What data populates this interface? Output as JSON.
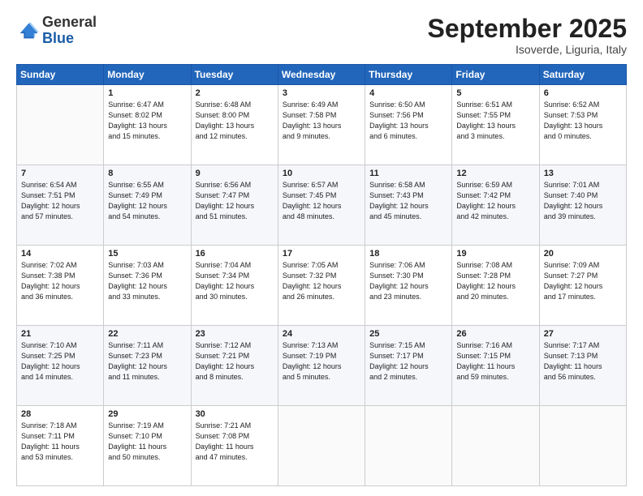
{
  "header": {
    "logo_general": "General",
    "logo_blue": "Blue",
    "month_title": "September 2025",
    "location": "Isoverde, Liguria, Italy"
  },
  "days_of_week": [
    "Sunday",
    "Monday",
    "Tuesday",
    "Wednesday",
    "Thursday",
    "Friday",
    "Saturday"
  ],
  "weeks": [
    [
      {
        "num": "",
        "info": ""
      },
      {
        "num": "1",
        "info": "Sunrise: 6:47 AM\nSunset: 8:02 PM\nDaylight: 13 hours\nand 15 minutes."
      },
      {
        "num": "2",
        "info": "Sunrise: 6:48 AM\nSunset: 8:00 PM\nDaylight: 13 hours\nand 12 minutes."
      },
      {
        "num": "3",
        "info": "Sunrise: 6:49 AM\nSunset: 7:58 PM\nDaylight: 13 hours\nand 9 minutes."
      },
      {
        "num": "4",
        "info": "Sunrise: 6:50 AM\nSunset: 7:56 PM\nDaylight: 13 hours\nand 6 minutes."
      },
      {
        "num": "5",
        "info": "Sunrise: 6:51 AM\nSunset: 7:55 PM\nDaylight: 13 hours\nand 3 minutes."
      },
      {
        "num": "6",
        "info": "Sunrise: 6:52 AM\nSunset: 7:53 PM\nDaylight: 13 hours\nand 0 minutes."
      }
    ],
    [
      {
        "num": "7",
        "info": "Sunrise: 6:54 AM\nSunset: 7:51 PM\nDaylight: 12 hours\nand 57 minutes."
      },
      {
        "num": "8",
        "info": "Sunrise: 6:55 AM\nSunset: 7:49 PM\nDaylight: 12 hours\nand 54 minutes."
      },
      {
        "num": "9",
        "info": "Sunrise: 6:56 AM\nSunset: 7:47 PM\nDaylight: 12 hours\nand 51 minutes."
      },
      {
        "num": "10",
        "info": "Sunrise: 6:57 AM\nSunset: 7:45 PM\nDaylight: 12 hours\nand 48 minutes."
      },
      {
        "num": "11",
        "info": "Sunrise: 6:58 AM\nSunset: 7:43 PM\nDaylight: 12 hours\nand 45 minutes."
      },
      {
        "num": "12",
        "info": "Sunrise: 6:59 AM\nSunset: 7:42 PM\nDaylight: 12 hours\nand 42 minutes."
      },
      {
        "num": "13",
        "info": "Sunrise: 7:01 AM\nSunset: 7:40 PM\nDaylight: 12 hours\nand 39 minutes."
      }
    ],
    [
      {
        "num": "14",
        "info": "Sunrise: 7:02 AM\nSunset: 7:38 PM\nDaylight: 12 hours\nand 36 minutes."
      },
      {
        "num": "15",
        "info": "Sunrise: 7:03 AM\nSunset: 7:36 PM\nDaylight: 12 hours\nand 33 minutes."
      },
      {
        "num": "16",
        "info": "Sunrise: 7:04 AM\nSunset: 7:34 PM\nDaylight: 12 hours\nand 30 minutes."
      },
      {
        "num": "17",
        "info": "Sunrise: 7:05 AM\nSunset: 7:32 PM\nDaylight: 12 hours\nand 26 minutes."
      },
      {
        "num": "18",
        "info": "Sunrise: 7:06 AM\nSunset: 7:30 PM\nDaylight: 12 hours\nand 23 minutes."
      },
      {
        "num": "19",
        "info": "Sunrise: 7:08 AM\nSunset: 7:28 PM\nDaylight: 12 hours\nand 20 minutes."
      },
      {
        "num": "20",
        "info": "Sunrise: 7:09 AM\nSunset: 7:27 PM\nDaylight: 12 hours\nand 17 minutes."
      }
    ],
    [
      {
        "num": "21",
        "info": "Sunrise: 7:10 AM\nSunset: 7:25 PM\nDaylight: 12 hours\nand 14 minutes."
      },
      {
        "num": "22",
        "info": "Sunrise: 7:11 AM\nSunset: 7:23 PM\nDaylight: 12 hours\nand 11 minutes."
      },
      {
        "num": "23",
        "info": "Sunrise: 7:12 AM\nSunset: 7:21 PM\nDaylight: 12 hours\nand 8 minutes."
      },
      {
        "num": "24",
        "info": "Sunrise: 7:13 AM\nSunset: 7:19 PM\nDaylight: 12 hours\nand 5 minutes."
      },
      {
        "num": "25",
        "info": "Sunrise: 7:15 AM\nSunset: 7:17 PM\nDaylight: 12 hours\nand 2 minutes."
      },
      {
        "num": "26",
        "info": "Sunrise: 7:16 AM\nSunset: 7:15 PM\nDaylight: 11 hours\nand 59 minutes."
      },
      {
        "num": "27",
        "info": "Sunrise: 7:17 AM\nSunset: 7:13 PM\nDaylight: 11 hours\nand 56 minutes."
      }
    ],
    [
      {
        "num": "28",
        "info": "Sunrise: 7:18 AM\nSunset: 7:11 PM\nDaylight: 11 hours\nand 53 minutes."
      },
      {
        "num": "29",
        "info": "Sunrise: 7:19 AM\nSunset: 7:10 PM\nDaylight: 11 hours\nand 50 minutes."
      },
      {
        "num": "30",
        "info": "Sunrise: 7:21 AM\nSunset: 7:08 PM\nDaylight: 11 hours\nand 47 minutes."
      },
      {
        "num": "",
        "info": ""
      },
      {
        "num": "",
        "info": ""
      },
      {
        "num": "",
        "info": ""
      },
      {
        "num": "",
        "info": ""
      }
    ]
  ]
}
